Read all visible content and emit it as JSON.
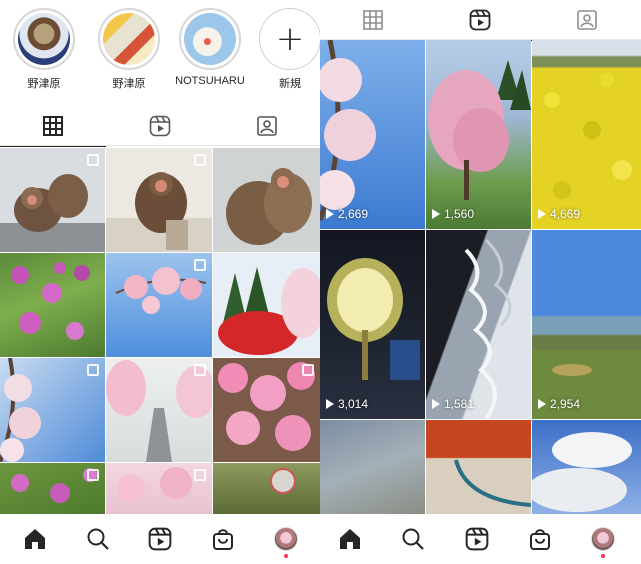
{
  "left": {
    "stories": [
      {
        "label": "野津原"
      },
      {
        "label": "野津原"
      },
      {
        "label": "NOTSUHARU"
      },
      {
        "label": "新規"
      }
    ],
    "tabs": [
      "grid-icon",
      "reels-icon",
      "tagged-icon"
    ],
    "nav": [
      "home-icon",
      "search-icon",
      "reels-icon",
      "shop-icon",
      "profile-avatar"
    ]
  },
  "right": {
    "tabs": [
      "grid-icon",
      "reels-icon",
      "tagged-icon"
    ],
    "reels": [
      {
        "views": "2,669"
      },
      {
        "views": "1,560"
      },
      {
        "views": "4,669"
      },
      {
        "views": "3,014"
      },
      {
        "views": "1,581"
      },
      {
        "views": "2,954"
      }
    ],
    "nav": [
      "home-icon",
      "search-icon",
      "reels-icon",
      "shop-icon",
      "profile-avatar"
    ]
  },
  "colors": {
    "text": "#262626",
    "divider": "#e6e6e6",
    "notification": "#ff2d55"
  }
}
